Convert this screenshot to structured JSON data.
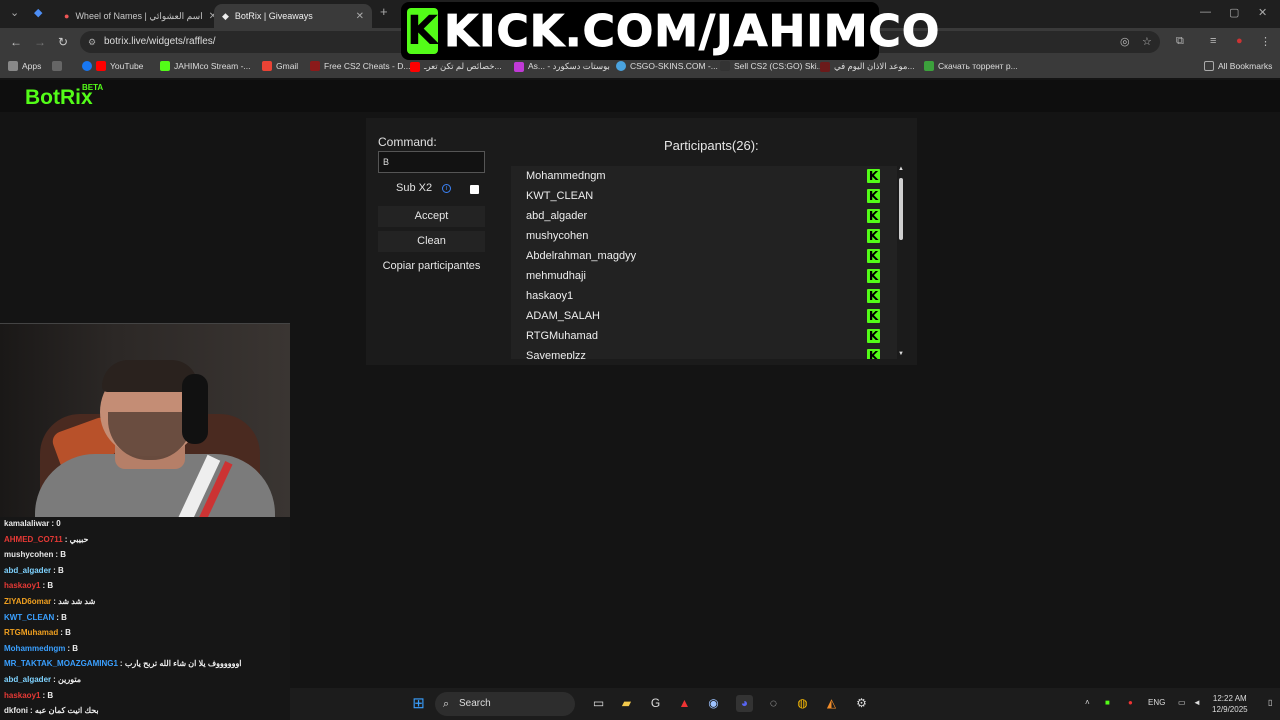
{
  "browser": {
    "tabs": [
      {
        "label": "Wheel of Names | اسم العشوائي"
      },
      {
        "label": "BotRix | Giveaways"
      }
    ],
    "url": "botrix.live/widgets/raffles/",
    "bookmarks": [
      "Apps",
      "YouTube",
      "JAHIMco Stream -...",
      "Gmail",
      "Free CS2 Cheats - D...",
      "خصائص لم تكن تعرـ...",
      "As... - بوستات دسكورد",
      "CSGO-SKINS.COM -...",
      "Sell CS2 (CS:GO) Ski...",
      "موعد الاذان اليوم في...",
      "Скачать торрент р...",
      "All Bookmarks"
    ]
  },
  "overlay": {
    "kick_letter": "K",
    "banner_text": "KICK.COM/JAHIMCO"
  },
  "site": {
    "logo": "BotRix",
    "beta": "BETA"
  },
  "raffle": {
    "command_label": "Command:",
    "command_value": "B",
    "sub_label": "Sub X2",
    "accept": "Accept",
    "clean": "Clean",
    "copy": "Copiar participantes",
    "participants_title": "Participants(26):",
    "participants": [
      "Mohammedngm",
      "KWT_CLEAN",
      "abd_algader",
      "mushycohen",
      "Abdelrahman_magdyy",
      "mehmudhaji",
      "haskaoy1",
      "ADAM_SALAH",
      "RTGMuhamad",
      "Savemeplzz"
    ]
  },
  "chat": [
    {
      "user": "kamalaliwar",
      "msg": "0",
      "color": "#e8e8e8"
    },
    {
      "user": "AHMED_CO711",
      "msg": "حبيبي",
      "color": "#e53935"
    },
    {
      "user": "mushycohen",
      "msg": "B",
      "color": "#e8e8e8"
    },
    {
      "user": "abd_algader",
      "msg": "B",
      "color": "#7fd3ff"
    },
    {
      "user": "haskaoy1",
      "msg": "B",
      "color": "#e53935"
    },
    {
      "user": "ZIYAD6omar",
      "msg": "شد شد شد",
      "color": "#f0a020"
    },
    {
      "user": "KWT_CLEAN",
      "msg": "B",
      "color": "#3aa0ff"
    },
    {
      "user": "RTGMuhamad",
      "msg": "B",
      "color": "#f0a020"
    },
    {
      "user": "Mohammedngm",
      "msg": "B",
      "color": "#3aa0ff"
    },
    {
      "user": "MR_TAKTAK_MOAZGAMING1",
      "msg": "اووووووف يلا ان شاء الله تربح يارب",
      "color": "#3aa0ff"
    },
    {
      "user": "abd_algader",
      "msg": "متورين",
      "color": "#7fd3ff"
    },
    {
      "user": "haskaoy1",
      "msg": "B",
      "color": "#e53935"
    },
    {
      "user": "dkfoni",
      "msg": "بحك اتيت كمان عبه",
      "color": "#e8e8e8"
    }
  ],
  "taskbar": {
    "search": "Search",
    "lang": "ENG",
    "time": "12:22 AM",
    "date": "12/9/2025"
  },
  "colors": {
    "kick_green": "#53fc18",
    "bg": "#141414"
  }
}
